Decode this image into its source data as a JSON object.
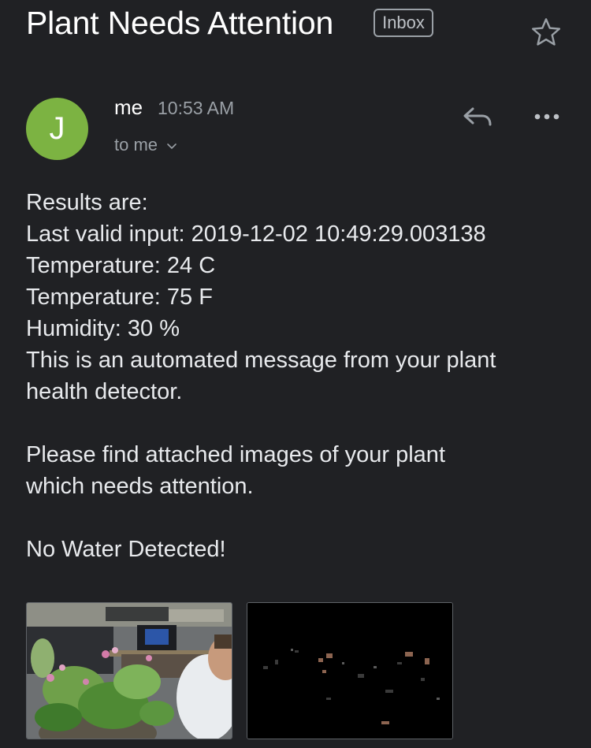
{
  "email": {
    "subject": "Plant Needs Attention",
    "label": "Inbox",
    "sender": {
      "initial": "J",
      "name": "me",
      "time": "10:53 AM",
      "recipient": "to me"
    },
    "body": {
      "lines_block1": [
        "Results are:",
        "Last valid input: 2019-12-02 10:49:29.003138",
        "Temperature: 24 C",
        "Temperature: 75 F",
        "Humidity: 30 %",
        "This is an automated message from your plant",
        "health detector."
      ],
      "lines_block2": [
        "Please find attached images of your plant",
        "which needs attention."
      ],
      "lines_block3": [
        "No Water Detected!"
      ]
    },
    "attachments": [
      {
        "type": "image",
        "description": "plant-photo"
      },
      {
        "type": "image",
        "description": "dark-mask-photo"
      }
    ]
  },
  "icons": {
    "star": "star-outline-icon",
    "reply": "reply-icon",
    "more": "more-horizontal-icon",
    "chevron": "chevron-down-icon"
  },
  "colors": {
    "background": "#202124",
    "avatar": "#7cb342",
    "text_primary": "#e8eaed",
    "text_secondary": "#9aa0a6"
  }
}
